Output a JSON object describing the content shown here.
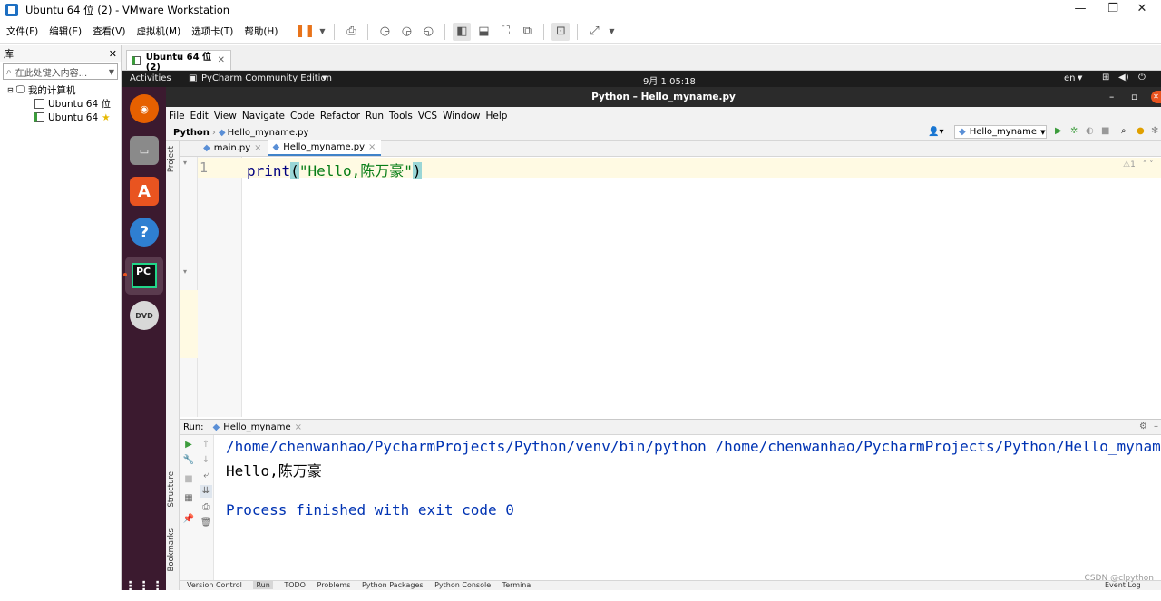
{
  "vmware": {
    "title": "Ubuntu 64 位 (2) - VMware Workstation",
    "menu": [
      "文件(F)",
      "编辑(E)",
      "查看(V)",
      "虚拟机(M)",
      "选项卡(T)",
      "帮助(H)"
    ],
    "library": {
      "title": "库",
      "search_placeholder": "在此处键入内容...",
      "tree": {
        "root": "我的计算机",
        "vm1": "Ubuntu 64 位",
        "vm2": "Ubuntu 64"
      }
    },
    "tab_label": "Ubuntu 64 位 (2)"
  },
  "ubuntu": {
    "activities": "Activities",
    "app_menu": "PyCharm Community Edition",
    "clock": "9月 1  05:18",
    "input_lang": "en"
  },
  "pycharm": {
    "window_title": "Python – Hello_myname.py",
    "menu": [
      "File",
      "Edit",
      "View",
      "Navigate",
      "Code",
      "Refactor",
      "Run",
      "Tools",
      "VCS",
      "Window",
      "Help"
    ],
    "breadcrumb": {
      "project": "Python",
      "file": "Hello_myname.py"
    },
    "run_config": "Hello_myname",
    "tabs": [
      {
        "label": "main.py",
        "active": false
      },
      {
        "label": "Hello_myname.py",
        "active": true
      }
    ],
    "side_labels": {
      "project": "Project",
      "structure": "Structure",
      "bookmarks": "Bookmarks"
    },
    "editor": {
      "line_number": "1",
      "code_fn": "print",
      "code_open": "(",
      "code_str": "\"Hello,陈万豪\"",
      "code_close": ")",
      "inspection": "1"
    },
    "run": {
      "label": "Run:",
      "tab": "Hello_myname",
      "output": {
        "command": "/home/chenwanhao/PycharmProjects/Python/venv/bin/python /home/chenwanhao/PycharmProjects/Python/Hello_myname.py",
        "stdout": "Hello,陈万豪",
        "exit": "Process finished with exit code 0"
      }
    },
    "statusbar": [
      "Version Control",
      "Run",
      "TODO",
      "Problems",
      "Python Packages",
      "Python Console",
      "Terminal"
    ],
    "event_log": "Event Log"
  },
  "watermark": "CSDN @clpython",
  "colors": {
    "dock_bg": "#3b1a2f",
    "code_string": "#067d17",
    "console_exit": "#0033b3"
  }
}
